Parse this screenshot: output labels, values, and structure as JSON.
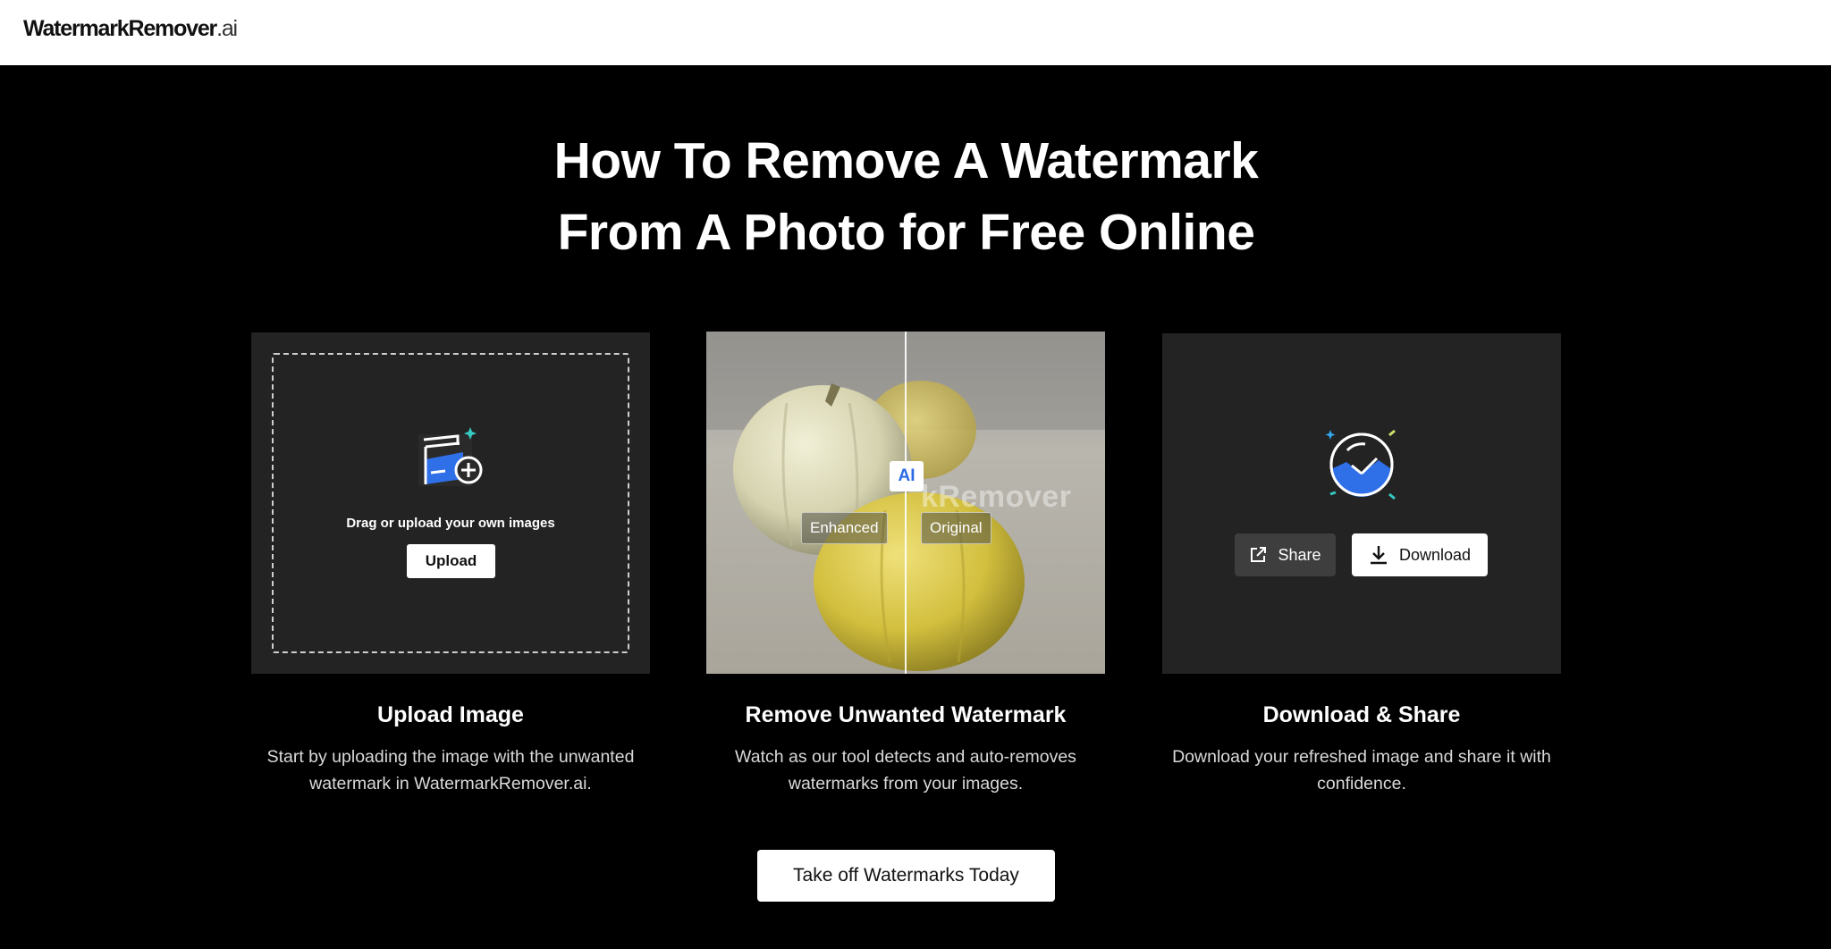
{
  "header": {
    "logo_main": "WatermarkRemover",
    "logo_suffix": ".ai"
  },
  "hero": {
    "title_line1": "How To Remove A Watermark",
    "title_line2": "From A Photo for Free Online"
  },
  "upload_card": {
    "drop_text": "Drag or upload your own images",
    "upload_label": "Upload"
  },
  "compare_card": {
    "ai_badge": "AI",
    "enhanced_label": "Enhanced",
    "original_label": "Original",
    "watermark_text": "kRemover"
  },
  "download_card": {
    "share_label": "Share",
    "download_label": "Download"
  },
  "steps": [
    {
      "title": "Upload Image",
      "description": "Start by uploading the image with the unwanted watermark in WatermarkRemover.ai."
    },
    {
      "title": "Remove Unwanted Watermark",
      "description": "Watch as our tool detects and auto-removes watermarks from your images."
    },
    {
      "title": "Download & Share",
      "description": "Download your refreshed image and share it with confidence."
    }
  ],
  "cta": {
    "label": "Take off Watermarks Today"
  },
  "colors": {
    "accent_blue": "#2f6fe8",
    "teal": "#35c9c2",
    "lime": "#c9e36a",
    "card_bg": "#232323"
  },
  "icons": [
    "image-upload-icon",
    "plus-circle-icon",
    "sparkle-icon",
    "clock-icon",
    "share-icon",
    "download-icon"
  ]
}
